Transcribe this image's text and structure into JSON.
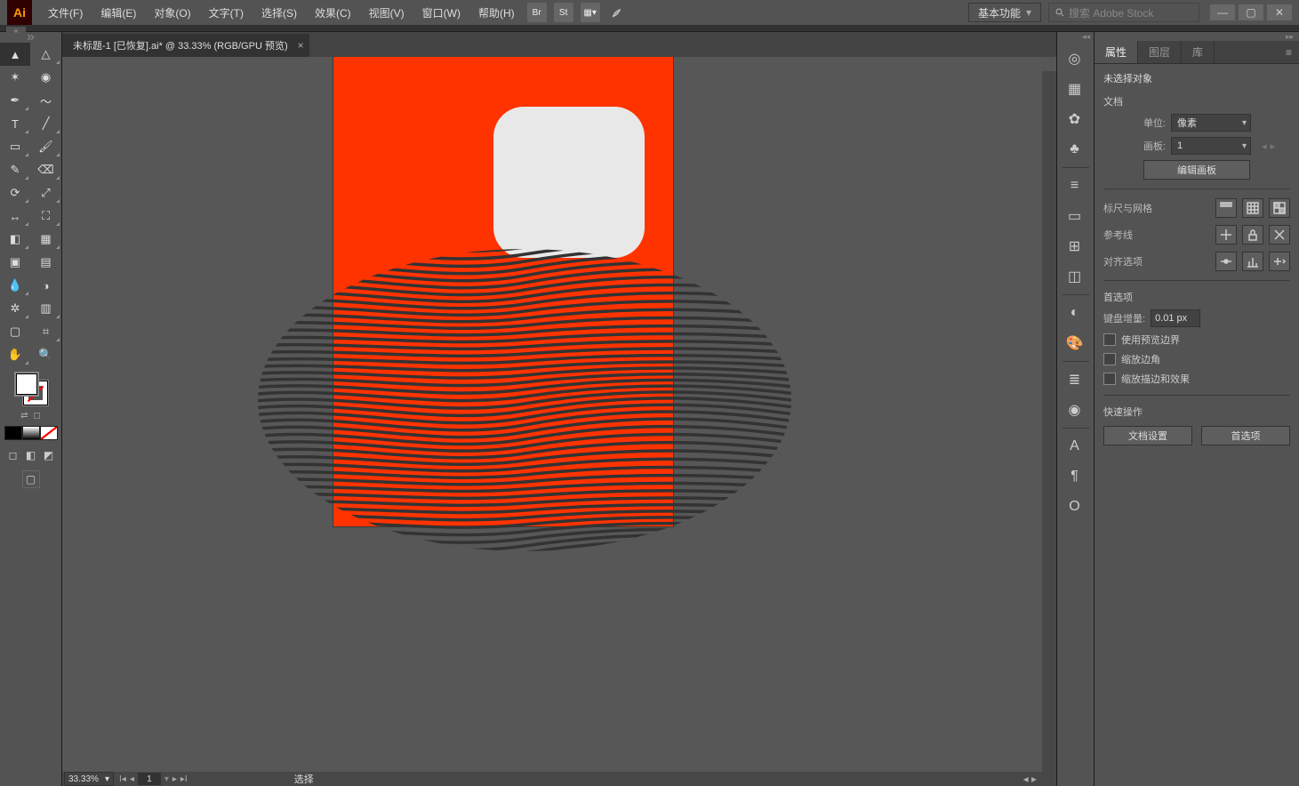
{
  "menu": {
    "items": [
      "文件(F)",
      "编辑(E)",
      "对象(O)",
      "文字(T)",
      "选择(S)",
      "效果(C)",
      "视图(V)",
      "窗口(W)",
      "帮助(H)"
    ],
    "bridge": "Br",
    "stock": "St",
    "workspace": "基本功能",
    "search_placeholder": "搜索 Adobe Stock"
  },
  "tab": {
    "title": "未标题-1 [已恢复].ai* @ 33.33% (RGB/GPU 预览)"
  },
  "status": {
    "zoom": "33.33%",
    "artboard_num": "1",
    "tool": "选择"
  },
  "tools": [
    {
      "name": "selection-tool",
      "glyph": "▲",
      "active": true,
      "tri": false
    },
    {
      "name": "direct-selection-tool",
      "glyph": "△",
      "tri": true
    },
    {
      "name": "magic-wand-tool",
      "glyph": "✶",
      "tri": false
    },
    {
      "name": "lasso-tool",
      "glyph": "◉",
      "tri": false
    },
    {
      "name": "pen-tool",
      "glyph": "✒",
      "tri": true
    },
    {
      "name": "curvature-tool",
      "glyph": "〜",
      "tri": false
    },
    {
      "name": "type-tool",
      "glyph": "T",
      "tri": true
    },
    {
      "name": "line-tool",
      "glyph": "╱",
      "tri": true
    },
    {
      "name": "rectangle-tool",
      "glyph": "▭",
      "tri": true
    },
    {
      "name": "paintbrush-tool",
      "glyph": "🖌",
      "tri": true
    },
    {
      "name": "shaper-tool",
      "glyph": "✎",
      "tri": true
    },
    {
      "name": "eraser-tool",
      "glyph": "⌫",
      "tri": true
    },
    {
      "name": "rotate-tool",
      "glyph": "⟳",
      "tri": true
    },
    {
      "name": "scale-tool",
      "glyph": "⤢",
      "tri": true
    },
    {
      "name": "width-tool",
      "glyph": "↔",
      "tri": true
    },
    {
      "name": "free-transform-tool",
      "glyph": "⛶",
      "tri": true
    },
    {
      "name": "shape-builder-tool",
      "glyph": "◧",
      "tri": true
    },
    {
      "name": "perspective-grid-tool",
      "glyph": "▦",
      "tri": true
    },
    {
      "name": "mesh-tool",
      "glyph": "▣",
      "tri": false
    },
    {
      "name": "gradient-tool",
      "glyph": "▤",
      "tri": false
    },
    {
      "name": "eyedropper-tool",
      "glyph": "💧",
      "tri": true
    },
    {
      "name": "blend-tool",
      "glyph": "◑",
      "tri": false
    },
    {
      "name": "symbol-sprayer-tool",
      "glyph": "✲",
      "tri": true
    },
    {
      "name": "column-graph-tool",
      "glyph": "▥",
      "tri": true
    },
    {
      "name": "artboard-tool",
      "glyph": "▢",
      "tri": false
    },
    {
      "name": "slice-tool",
      "glyph": "⌗",
      "tri": true
    },
    {
      "name": "hand-tool",
      "glyph": "✋",
      "tri": true
    },
    {
      "name": "zoom-tool",
      "glyph": "🔍",
      "tri": false
    }
  ],
  "dock": [
    {
      "name": "ai-themes-icon",
      "glyph": "◎"
    },
    {
      "name": "swatches-icon",
      "glyph": "▦"
    },
    {
      "name": "brushes-icon",
      "glyph": "✿"
    },
    {
      "name": "symbols-icon",
      "glyph": "♣"
    },
    {
      "divider": true
    },
    {
      "name": "stroke-icon",
      "glyph": "≡"
    },
    {
      "name": "align-icon",
      "glyph": "▭"
    },
    {
      "name": "transform-icon",
      "glyph": "⊞"
    },
    {
      "name": "pathfinder-icon",
      "glyph": "◫"
    },
    {
      "divider": true
    },
    {
      "name": "transparency-icon",
      "glyph": "◐"
    },
    {
      "name": "color-icon",
      "glyph": "🎨"
    },
    {
      "divider": true
    },
    {
      "name": "appearance-icon",
      "glyph": "≣"
    },
    {
      "name": "graphic-styles-icon",
      "glyph": "◉"
    },
    {
      "divider": true
    },
    {
      "name": "character-icon",
      "glyph": "A"
    },
    {
      "name": "paragraph-icon",
      "glyph": "¶"
    },
    {
      "name": "opentype-icon",
      "glyph": "O"
    }
  ],
  "panel": {
    "tabs": {
      "properties": "属性",
      "layers": "图层",
      "libraries": "库"
    },
    "no_selection": "未选择对象",
    "sect_document": "文档",
    "units_label": "单位:",
    "units_value": "像素",
    "artboard_label": "画板:",
    "artboard_value": "1",
    "edit_artboards_btn": "编辑画板",
    "rulers_grid_label": "标尺与网格",
    "guides_label": "参考线",
    "snap_label": "对齐选项",
    "sect_prefs": "首选项",
    "key_increment_label": "键盘增量:",
    "key_increment_value": "0.01 px",
    "cb_preview_bounds": "使用预览边界",
    "cb_scale_corners": "缩放边角",
    "cb_scale_strokes": "缩放描边和效果",
    "sect_quick": "快速操作",
    "btn_doc_setup": "文档设置",
    "btn_prefs": "首选项"
  }
}
